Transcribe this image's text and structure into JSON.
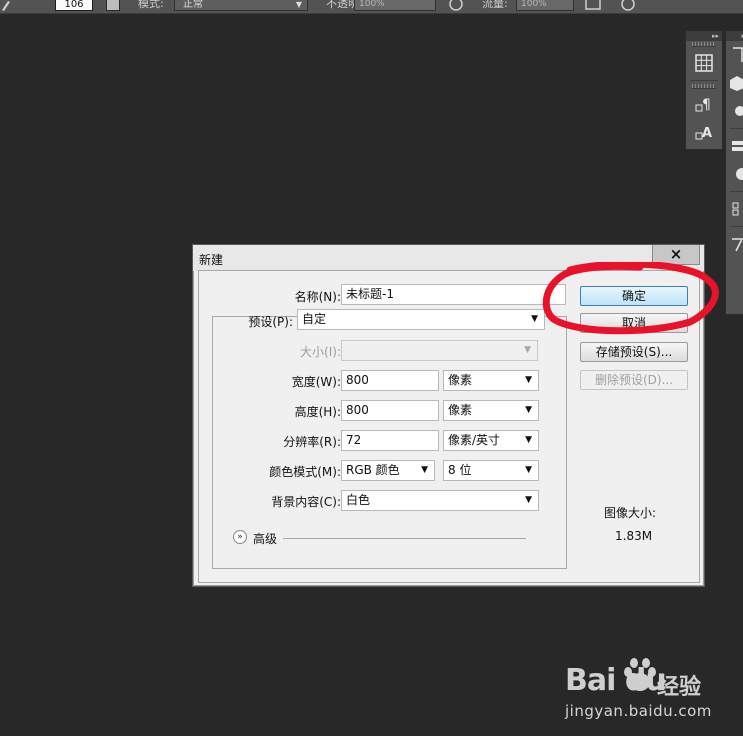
{
  "options_bar": {
    "brush_size": "106",
    "mode_label": "模式:",
    "mode_value": "正常",
    "opacity_label": "不透明度:",
    "opacity_value": "100%",
    "flow_label": "流量:",
    "flow_value": "100%"
  },
  "dialog": {
    "title": "新建",
    "close_symbol": "×",
    "fields": {
      "name_label": "名称(N):",
      "name_value": "未标题-1",
      "preset_label": "预设(P):",
      "preset_value": "自定",
      "size_label": "大小(I):",
      "size_value": "",
      "width_label": "宽度(W):",
      "width_value": "800",
      "width_unit": "像素",
      "height_label": "高度(H):",
      "height_value": "800",
      "height_unit": "像素",
      "resolution_label": "分辨率(R):",
      "resolution_value": "72",
      "resolution_unit": "像素/英寸",
      "color_mode_label": "颜色模式(M):",
      "color_mode_value": "RGB 颜色",
      "bit_depth_value": "8 位",
      "background_label": "背景内容(C):",
      "background_value": "白色"
    },
    "advanced_label": "高级",
    "buttons": {
      "ok": "确定",
      "cancel": "取消",
      "save_preset": "存储预设(S)...",
      "delete_preset": "删除预设(D)..."
    },
    "image_size_label": "图像大小:",
    "image_size_value": "1.83M"
  },
  "annotation": {
    "color": "#e8132a"
  },
  "watermark": {
    "logo": "Bai du",
    "suffix": "经验",
    "url": "jingyan.baidu.com"
  }
}
